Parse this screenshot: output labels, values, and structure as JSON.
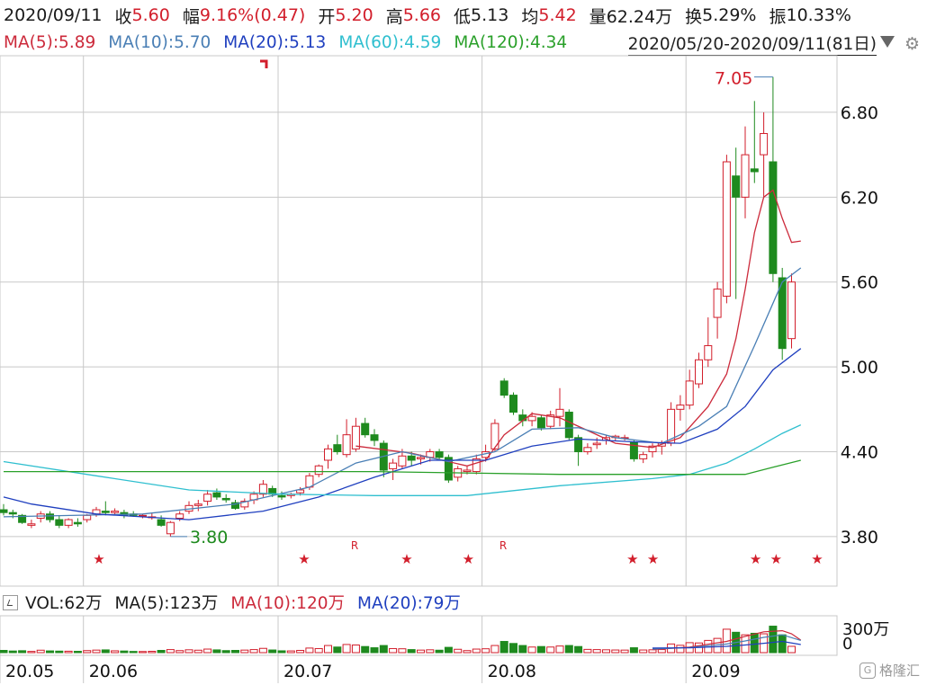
{
  "info": {
    "date": "2020/09/11",
    "close_label": "收",
    "close": "5.60",
    "change_label": "幅",
    "change": "9.16%(0.47)",
    "open_label": "开",
    "open": "5.20",
    "high_label": "高",
    "high": "5.66",
    "low_label": "低",
    "low": "5.13",
    "avg_label": "均",
    "avg": "5.42",
    "volume_label": "量",
    "volume": "62.24万",
    "turnover_label": "换",
    "turnover": "5.29%",
    "amplitude_label": "振",
    "amplitude": "10.33%"
  },
  "ma_legend": {
    "ma5": "MA(5):5.89",
    "ma10": "MA(10):5.70",
    "ma20": "MA(20):5.13",
    "ma60": "MA(60):4.59",
    "ma120": "MA(120):4.34"
  },
  "range_label": "2020/05/20-2020/09/11(81日)",
  "volume_legend": {
    "vol": "VOL:62万",
    "ma5": "MA(5):123万",
    "ma10": "MA(10):120万",
    "ma20": "MA(20):79万"
  },
  "colors": {
    "up": "#d21e2b",
    "down": "#1e8a1e",
    "ma5": "#cc2a3b",
    "ma10": "#4a7fb5",
    "ma20": "#1f3fbf",
    "ma60": "#2fbfcf",
    "ma120": "#2aa02a",
    "grid": "#c8c8c8",
    "axis_text": "#111111"
  },
  "watermark": "格隆汇",
  "chart_data": {
    "type": "candlestick",
    "price_ylim": [
      3.45,
      7.2
    ],
    "y_ticks": [
      "6.80",
      "6.20",
      "5.60",
      "5.00",
      "4.40",
      "3.80"
    ],
    "x_ticks": [
      "20.05",
      "20.06",
      "20.07",
      "20.08",
      "20.09"
    ],
    "volume_ticks": [
      "300万",
      "0"
    ],
    "annotations": {
      "high": "7.05",
      "low": "3.80"
    },
    "candles": [
      {
        "o": 3.99,
        "h": 4.03,
        "l": 3.95,
        "c": 3.97,
        "v": 22
      },
      {
        "o": 3.97,
        "h": 3.99,
        "l": 3.93,
        "c": 3.96,
        "v": 16
      },
      {
        "o": 3.95,
        "h": 3.96,
        "l": 3.89,
        "c": 3.9,
        "v": 19
      },
      {
        "o": 3.88,
        "h": 3.92,
        "l": 3.86,
        "c": 3.89,
        "v": 12
      },
      {
        "o": 3.93,
        "h": 3.98,
        "l": 3.9,
        "c": 3.96,
        "v": 24
      },
      {
        "o": 3.96,
        "h": 3.98,
        "l": 3.9,
        "c": 3.92,
        "v": 17
      },
      {
        "o": 3.92,
        "h": 3.95,
        "l": 3.86,
        "c": 3.88,
        "v": 15
      },
      {
        "o": 3.88,
        "h": 3.93,
        "l": 3.86,
        "c": 3.92,
        "v": 14
      },
      {
        "o": 3.9,
        "h": 3.93,
        "l": 3.87,
        "c": 3.89,
        "v": 13
      },
      {
        "o": 3.92,
        "h": 3.96,
        "l": 3.9,
        "c": 3.95,
        "v": 20
      },
      {
        "o": 3.96,
        "h": 4.01,
        "l": 3.94,
        "c": 3.99,
        "v": 25
      },
      {
        "o": 3.98,
        "h": 4.05,
        "l": 3.95,
        "c": 3.97,
        "v": 27
      },
      {
        "o": 3.97,
        "h": 4.0,
        "l": 3.95,
        "c": 3.98,
        "v": 18
      },
      {
        "o": 3.97,
        "h": 3.99,
        "l": 3.93,
        "c": 3.95,
        "v": 16
      },
      {
        "o": 3.96,
        "h": 3.98,
        "l": 3.94,
        "c": 3.95,
        "v": 12
      },
      {
        "o": 3.95,
        "h": 3.96,
        "l": 3.93,
        "c": 3.95,
        "v": 11
      },
      {
        "o": 3.94,
        "h": 3.97,
        "l": 3.92,
        "c": 3.94,
        "v": 13
      },
      {
        "o": 3.92,
        "h": 3.95,
        "l": 3.87,
        "c": 3.88,
        "v": 22
      },
      {
        "o": 3.82,
        "h": 3.91,
        "l": 3.8,
        "c": 3.9,
        "v": 30
      },
      {
        "o": 3.93,
        "h": 3.98,
        "l": 3.91,
        "c": 3.96,
        "v": 20
      },
      {
        "o": 3.98,
        "h": 4.05,
        "l": 3.96,
        "c": 4.02,
        "v": 28
      },
      {
        "o": 4.02,
        "h": 4.06,
        "l": 3.98,
        "c": 4.03,
        "v": 24
      },
      {
        "o": 4.05,
        "h": 4.13,
        "l": 4.02,
        "c": 4.1,
        "v": 35
      },
      {
        "o": 4.11,
        "h": 4.14,
        "l": 4.06,
        "c": 4.08,
        "v": 27
      },
      {
        "o": 4.07,
        "h": 4.1,
        "l": 4.04,
        "c": 4.06,
        "v": 20
      },
      {
        "o": 4.04,
        "h": 4.06,
        "l": 3.99,
        "c": 4.0,
        "v": 22
      },
      {
        "o": 4.01,
        "h": 4.07,
        "l": 3.99,
        "c": 4.05,
        "v": 25
      },
      {
        "o": 4.06,
        "h": 4.12,
        "l": 4.03,
        "c": 4.1,
        "v": 30
      },
      {
        "o": 4.1,
        "h": 4.2,
        "l": 4.08,
        "c": 4.17,
        "v": 42
      },
      {
        "o": 4.14,
        "h": 4.16,
        "l": 4.08,
        "c": 4.1,
        "v": 26
      },
      {
        "o": 4.09,
        "h": 4.12,
        "l": 4.06,
        "c": 4.08,
        "v": 18
      },
      {
        "o": 4.09,
        "h": 4.11,
        "l": 4.07,
        "c": 4.1,
        "v": 17
      },
      {
        "o": 4.11,
        "h": 4.15,
        "l": 4.09,
        "c": 4.13,
        "v": 22
      },
      {
        "o": 4.15,
        "h": 4.25,
        "l": 4.13,
        "c": 4.23,
        "v": 45
      },
      {
        "o": 4.24,
        "h": 4.31,
        "l": 4.22,
        "c": 4.3,
        "v": 40
      },
      {
        "o": 4.34,
        "h": 4.45,
        "l": 4.28,
        "c": 4.42,
        "v": 70
      },
      {
        "o": 4.45,
        "h": 4.52,
        "l": 4.38,
        "c": 4.4,
        "v": 55
      },
      {
        "o": 4.38,
        "h": 4.63,
        "l": 4.36,
        "c": 4.52,
        "v": 80
      },
      {
        "o": 4.42,
        "h": 4.64,
        "l": 4.4,
        "c": 4.58,
        "v": 75
      },
      {
        "o": 4.6,
        "h": 4.64,
        "l": 4.5,
        "c": 4.52,
        "v": 60
      },
      {
        "o": 4.52,
        "h": 4.56,
        "l": 4.44,
        "c": 4.48,
        "v": 48
      },
      {
        "o": 4.46,
        "h": 4.48,
        "l": 4.22,
        "c": 4.27,
        "v": 70
      },
      {
        "o": 4.28,
        "h": 4.35,
        "l": 4.2,
        "c": 4.32,
        "v": 40
      },
      {
        "o": 4.3,
        "h": 4.42,
        "l": 4.28,
        "c": 4.37,
        "v": 38
      },
      {
        "o": 4.37,
        "h": 4.4,
        "l": 4.3,
        "c": 4.34,
        "v": 30
      },
      {
        "o": 4.35,
        "h": 4.38,
        "l": 4.31,
        "c": 4.36,
        "v": 25
      },
      {
        "o": 4.36,
        "h": 4.42,
        "l": 4.33,
        "c": 4.4,
        "v": 28
      },
      {
        "o": 4.4,
        "h": 4.42,
        "l": 4.34,
        "c": 4.36,
        "v": 24
      },
      {
        "o": 4.36,
        "h": 4.38,
        "l": 4.18,
        "c": 4.2,
        "v": 52
      },
      {
        "o": 4.22,
        "h": 4.3,
        "l": 4.19,
        "c": 4.28,
        "v": 33
      },
      {
        "o": 4.26,
        "h": 4.3,
        "l": 4.24,
        "c": 4.27,
        "v": 20
      },
      {
        "o": 4.26,
        "h": 4.38,
        "l": 4.24,
        "c": 4.35,
        "v": 35
      },
      {
        "o": 4.36,
        "h": 4.45,
        "l": 4.33,
        "c": 4.4,
        "v": 38
      },
      {
        "o": 4.42,
        "h": 4.63,
        "l": 4.4,
        "c": 4.6,
        "v": 70
      },
      {
        "o": 4.9,
        "h": 4.92,
        "l": 4.78,
        "c": 4.8,
        "v": 110
      },
      {
        "o": 4.8,
        "h": 4.82,
        "l": 4.66,
        "c": 4.68,
        "v": 90
      },
      {
        "o": 4.66,
        "h": 4.7,
        "l": 4.58,
        "c": 4.62,
        "v": 70
      },
      {
        "o": 4.62,
        "h": 4.68,
        "l": 4.58,
        "c": 4.65,
        "v": 55
      },
      {
        "o": 4.64,
        "h": 4.66,
        "l": 4.55,
        "c": 4.57,
        "v": 60
      },
      {
        "o": 4.58,
        "h": 4.69,
        "l": 4.56,
        "c": 4.66,
        "v": 55
      },
      {
        "o": 4.65,
        "h": 4.85,
        "l": 4.58,
        "c": 4.7,
        "v": 65
      },
      {
        "o": 4.68,
        "h": 4.7,
        "l": 4.48,
        "c": 4.5,
        "v": 70
      },
      {
        "o": 4.5,
        "h": 4.52,
        "l": 4.3,
        "c": 4.4,
        "v": 60
      },
      {
        "o": 4.4,
        "h": 4.46,
        "l": 4.38,
        "c": 4.43,
        "v": 32
      },
      {
        "o": 4.45,
        "h": 4.5,
        "l": 4.42,
        "c": 4.46,
        "v": 30
      },
      {
        "o": 4.48,
        "h": 4.52,
        "l": 4.45,
        "c": 4.5,
        "v": 28
      },
      {
        "o": 4.5,
        "h": 4.52,
        "l": 4.48,
        "c": 4.51,
        "v": 26
      },
      {
        "o": 4.5,
        "h": 4.52,
        "l": 4.48,
        "c": 4.5,
        "v": 25
      },
      {
        "o": 4.47,
        "h": 4.48,
        "l": 4.33,
        "c": 4.35,
        "v": 48
      },
      {
        "o": 4.35,
        "h": 4.4,
        "l": 4.32,
        "c": 4.38,
        "v": 26
      },
      {
        "o": 4.4,
        "h": 4.46,
        "l": 4.36,
        "c": 4.44,
        "v": 28
      },
      {
        "o": 4.44,
        "h": 4.48,
        "l": 4.38,
        "c": 4.46,
        "v": 30
      },
      {
        "o": 4.46,
        "h": 4.75,
        "l": 4.44,
        "c": 4.7,
        "v": 85
      },
      {
        "o": 4.7,
        "h": 4.8,
        "l": 4.62,
        "c": 4.73,
        "v": 72
      },
      {
        "o": 4.73,
        "h": 4.98,
        "l": 4.7,
        "c": 4.9,
        "v": 98
      },
      {
        "o": 4.88,
        "h": 5.1,
        "l": 4.85,
        "c": 5.05,
        "v": 95
      },
      {
        "o": 5.05,
        "h": 5.35,
        "l": 5.0,
        "c": 5.15,
        "v": 120
      },
      {
        "o": 5.35,
        "h": 5.6,
        "l": 5.2,
        "c": 5.55,
        "v": 140
      },
      {
        "o": 5.5,
        "h": 6.5,
        "l": 5.45,
        "c": 6.45,
        "v": 230
      },
      {
        "o": 6.35,
        "h": 6.55,
        "l": 5.48,
        "c": 6.2,
        "v": 200
      },
      {
        "o": 6.2,
        "h": 6.7,
        "l": 6.05,
        "c": 6.5,
        "v": 175
      },
      {
        "o": 6.4,
        "h": 6.88,
        "l": 6.3,
        "c": 6.38,
        "v": 190
      },
      {
        "o": 6.5,
        "h": 6.8,
        "l": 6.2,
        "c": 6.65,
        "v": 185
      },
      {
        "o": 6.45,
        "h": 7.05,
        "l": 5.6,
        "c": 5.66,
        "v": 260
      },
      {
        "o": 5.63,
        "h": 5.7,
        "l": 5.05,
        "c": 5.13,
        "v": 175
      },
      {
        "o": 5.2,
        "h": 5.66,
        "l": 5.13,
        "c": 5.6,
        "v": 62
      }
    ],
    "ma_series": {
      "ma5": [
        [
          38,
          4.44
        ],
        [
          44,
          4.39
        ],
        [
          50,
          4.3
        ],
        [
          52,
          4.34
        ],
        [
          54,
          4.52
        ],
        [
          57,
          4.67
        ],
        [
          60,
          4.64
        ],
        [
          63,
          4.55
        ],
        [
          66,
          4.46
        ],
        [
          70,
          4.43
        ],
        [
          73,
          4.5
        ],
        [
          76,
          4.72
        ],
        [
          78,
          4.95
        ],
        [
          79,
          5.2
        ],
        [
          80,
          5.55
        ],
        [
          81,
          5.95
        ],
        [
          82,
          6.2
        ],
        [
          83,
          6.25
        ],
        [
          84,
          6.05
        ],
        [
          85,
          5.88
        ],
        [
          86,
          5.89
        ]
      ],
      "ma10": [
        [
          0,
          3.94
        ],
        [
          15,
          3.96
        ],
        [
          25,
          4.03
        ],
        [
          33,
          4.15
        ],
        [
          38,
          4.32
        ],
        [
          43,
          4.4
        ],
        [
          48,
          4.33
        ],
        [
          53,
          4.4
        ],
        [
          57,
          4.56
        ],
        [
          62,
          4.57
        ],
        [
          66,
          4.5
        ],
        [
          71,
          4.46
        ],
        [
          75,
          4.58
        ],
        [
          78,
          4.72
        ],
        [
          81,
          5.15
        ],
        [
          84,
          5.6
        ],
        [
          86,
          5.7
        ]
      ],
      "ma20": [
        [
          0,
          4.08
        ],
        [
          3,
          4.03
        ],
        [
          10,
          3.96
        ],
        [
          20,
          3.92
        ],
        [
          28,
          3.98
        ],
        [
          34,
          4.08
        ],
        [
          40,
          4.22
        ],
        [
          46,
          4.34
        ],
        [
          52,
          4.34
        ],
        [
          57,
          4.44
        ],
        [
          62,
          4.49
        ],
        [
          68,
          4.47
        ],
        [
          73,
          4.46
        ],
        [
          77,
          4.56
        ],
        [
          80,
          4.72
        ],
        [
          83,
          4.98
        ],
        [
          86,
          5.13
        ]
      ],
      "ma60": [
        [
          0,
          4.33
        ],
        [
          10,
          4.23
        ],
        [
          20,
          4.13
        ],
        [
          30,
          4.1
        ],
        [
          40,
          4.09
        ],
        [
          50,
          4.09
        ],
        [
          60,
          4.16
        ],
        [
          70,
          4.21
        ],
        [
          74,
          4.24
        ],
        [
          78,
          4.32
        ],
        [
          81,
          4.42
        ],
        [
          84,
          4.53
        ],
        [
          86,
          4.59
        ]
      ],
      "ma120": [
        [
          0,
          4.26
        ],
        [
          20,
          4.26
        ],
        [
          40,
          4.26
        ],
        [
          60,
          4.24
        ],
        [
          76,
          4.24
        ],
        [
          80,
          4.24
        ],
        [
          83,
          4.29
        ],
        [
          86,
          4.34
        ]
      ]
    },
    "volume_ma": {
      "ma5": [
        [
          70,
          30
        ],
        [
          74,
          55
        ],
        [
          78,
          110
        ],
        [
          80,
          160
        ],
        [
          82,
          205
        ],
        [
          84,
          215
        ],
        [
          85,
          185
        ],
        [
          86,
          123
        ]
      ],
      "ma10": [
        [
          70,
          35
        ],
        [
          74,
          50
        ],
        [
          78,
          85
        ],
        [
          80,
          115
        ],
        [
          82,
          150
        ],
        [
          84,
          175
        ],
        [
          86,
          120
        ]
      ],
      "ma20": [
        [
          70,
          45
        ],
        [
          74,
          48
        ],
        [
          78,
          62
        ],
        [
          80,
          75
        ],
        [
          82,
          92
        ],
        [
          84,
          110
        ],
        [
          86,
          79
        ]
      ]
    },
    "star_markers": [
      5,
      15,
      20,
      23,
      31,
      32,
      37,
      38,
      40,
      47,
      49
    ],
    "r_markers": [
      22,
      32
    ],
    "volume_max": 300
  }
}
